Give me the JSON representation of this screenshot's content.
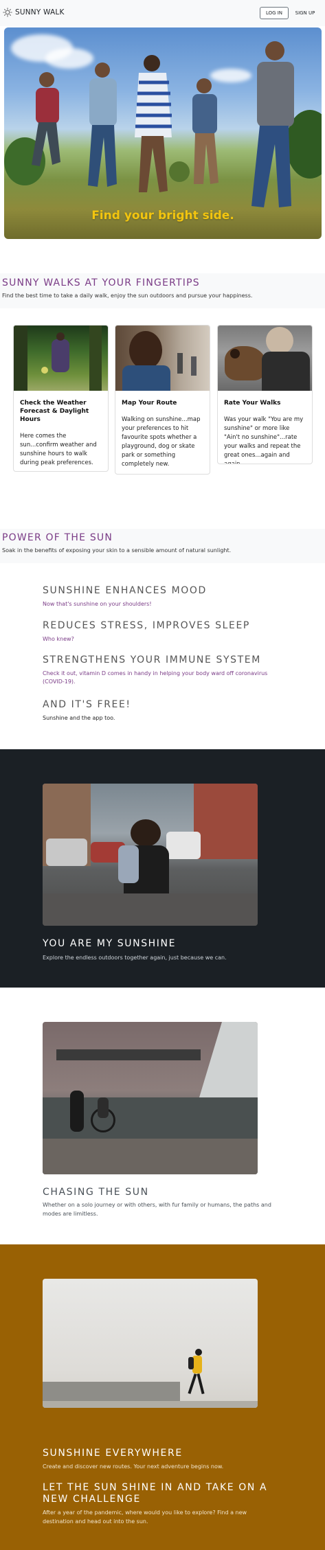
{
  "navbar": {
    "brand": "SUNNY WALK",
    "login_label": "LOG IN",
    "signup_label": "SIGN UP"
  },
  "hero": {
    "caption": "Find your bright side."
  },
  "fingertips": {
    "title": "SUNNY WALKS AT YOUR FINGERTIPS",
    "subtitle": "Find the best time to take a daily walk, enjoy the sun outdoors and pursue your happiness."
  },
  "cards": [
    {
      "title": "Check the Weather Forecast & Daylight Hours",
      "text": "Here comes the sun...confirm weather and sunshine hours to walk during peak preferences."
    },
    {
      "title": "Map Your Route",
      "text": "Walking on sunshine...map your preferences to hit favourite spots whether a playground, dog or skate park or something completely new."
    },
    {
      "title": "Rate Your Walks",
      "text": "Was your walk \"You are my sunshine\" or more like \"Ain't no sunshine\"...rate your walks and repeat the great ones...again and again."
    }
  ],
  "power": {
    "title": "POWER OF THE SUN",
    "subtitle": "Soak in the benefits of exposing your skin to a sensible amount of natural sunlight."
  },
  "benefits": [
    {
      "title": "SUNSHINE ENHANCES MOOD",
      "text": "Now that's sunshine on your shoulders!"
    },
    {
      "title": "REDUCES STRESS, IMPROVES SLEEP",
      "text": "Who knew?"
    },
    {
      "title": "STRENGTHENS YOUR IMMUNE SYSTEM",
      "text": "Check it out, vitamin D comes in handy in helping your body ward off coronavirus (COVID-19)."
    },
    {
      "title": "AND IT'S FREE!",
      "text": "Sunshine and the app too."
    }
  ],
  "features": {
    "sunshine": {
      "title": "YOU ARE MY SUNSHINE",
      "text": "Explore the endless outdoors together again, just because we can."
    },
    "chasing": {
      "title": "CHASING THE SUN",
      "text": "Whether on a solo journey or with others, with fur family or humans, the paths and modes are limitless."
    },
    "everywhere": {
      "title": "SUNSHINE EVERYWHERE",
      "text": "Create and discover new routes. Your next adventure begins now."
    },
    "challenge": {
      "title": "LET THE SUN SHINE IN AND TAKE ON A NEW CHALLENGE",
      "text": "After a year of the pandemic, where would you like to explore? Find a new destination and head out into the sun."
    }
  },
  "colors": {
    "accent_purple": "#7a3b86",
    "hero_caption": "#f2c50f",
    "dark_section": "#1b2025",
    "brown_section": "#996104"
  }
}
